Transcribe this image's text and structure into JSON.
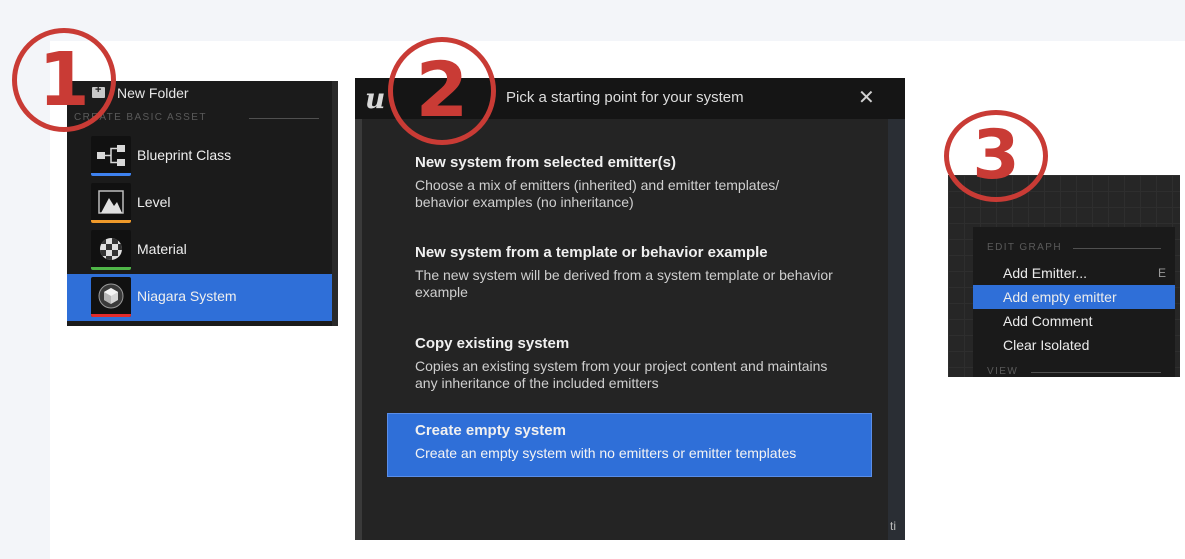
{
  "badges": [
    "1",
    "2",
    "3"
  ],
  "panel1": {
    "new_folder": "New Folder",
    "section": "CREATE BASIC ASSET",
    "items": [
      {
        "label": "Blueprint Class",
        "icon": "blueprint-icon",
        "color": "#3e82f0"
      },
      {
        "label": "Level",
        "icon": "level-icon",
        "color": "#f09a2a"
      },
      {
        "label": "Material",
        "icon": "material-icon",
        "color": "#4fb648"
      },
      {
        "label": "Niagara System",
        "icon": "niagara-icon",
        "color": "#e32b2b",
        "selected": true
      }
    ]
  },
  "panel2": {
    "logo": "u",
    "title": "Pick a starting point for your system",
    "close": "✕",
    "options": [
      {
        "head": "New system from selected emitter(s)",
        "desc": "Choose a mix of emitters (inherited) and emitter templates/ behavior examples (no inheritance)"
      },
      {
        "head": "New system from a template or behavior example",
        "desc": "The new system will be derived from a system template or behavior example"
      },
      {
        "head": "Copy existing system",
        "desc": "Copies an existing system from your project content and maintains any inheritance of the included emitters"
      },
      {
        "head": "Create empty system",
        "desc": "Create an empty system with no emitters or emitter templates",
        "selected": true
      }
    ],
    "frag": "ti"
  },
  "panel3": {
    "section": "EDIT GRAPH",
    "items": [
      {
        "label": "Add Emitter...",
        "shortcut": "E"
      },
      {
        "label": "Add empty emitter",
        "selected": true
      },
      {
        "label": "Add Comment"
      },
      {
        "label": "Clear Isolated"
      }
    ],
    "view": "VIEW"
  },
  "colors": {
    "accent": "#2f6fd8",
    "badge": "#c93b35"
  }
}
